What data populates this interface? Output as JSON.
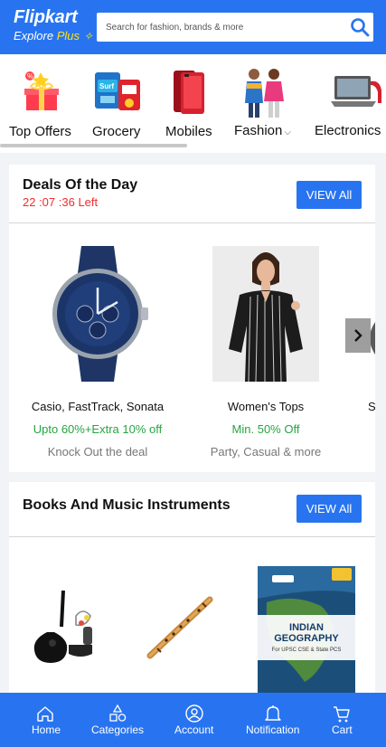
{
  "header": {
    "logo_name": "Flipkart",
    "logo_sub_explore": "Explore",
    "logo_sub_plus": "Plus",
    "search_placeholder": "Search for fashion, brands & more",
    "brand_color": "#2874f0",
    "accent_color": "#ffe11b"
  },
  "categories": [
    {
      "label": "Top Offers",
      "icon": "gift-offers"
    },
    {
      "label": "Grocery",
      "icon": "grocery-products"
    },
    {
      "label": "Mobiles",
      "icon": "mobile-phone"
    },
    {
      "label": "Fashion",
      "icon": "fashion-models",
      "dropdown": true
    },
    {
      "label": "Electronics",
      "icon": "laptop"
    }
  ],
  "deals": {
    "title": "Deals Of the Day",
    "timer": "22 :07 :36 Left",
    "view_all": "VIEW All",
    "items": [
      {
        "name": "Casio, FastTrack, Sonata",
        "offer": "Upto 60%+Extra 10% off",
        "sub": "Knock Out the deal",
        "image": "blue-watch"
      },
      {
        "name": "Women's Tops",
        "offer": "Min. 50% Off",
        "sub": "Party, Casual & more",
        "image": "striped-top"
      },
      {
        "name": "S",
        "image": "partial-product"
      }
    ]
  },
  "books": {
    "title": "Books And Music Instruments",
    "view_all": "VIEW All",
    "items": [
      {
        "image": "acoustic-guitar-kit"
      },
      {
        "image": "bamboo-flute"
      },
      {
        "image": "book-cover",
        "cover_title": "INDIAN GEOGRAPHY",
        "cover_small": "For UPSC CSE & State PCS"
      }
    ]
  },
  "bottom_nav": [
    {
      "label": "Home",
      "icon": "home-icon"
    },
    {
      "label": "Categories",
      "icon": "categories-icon"
    },
    {
      "label": "Account",
      "icon": "account-icon"
    },
    {
      "label": "Notification",
      "icon": "bell-icon"
    },
    {
      "label": "Cart",
      "icon": "cart-icon"
    }
  ]
}
